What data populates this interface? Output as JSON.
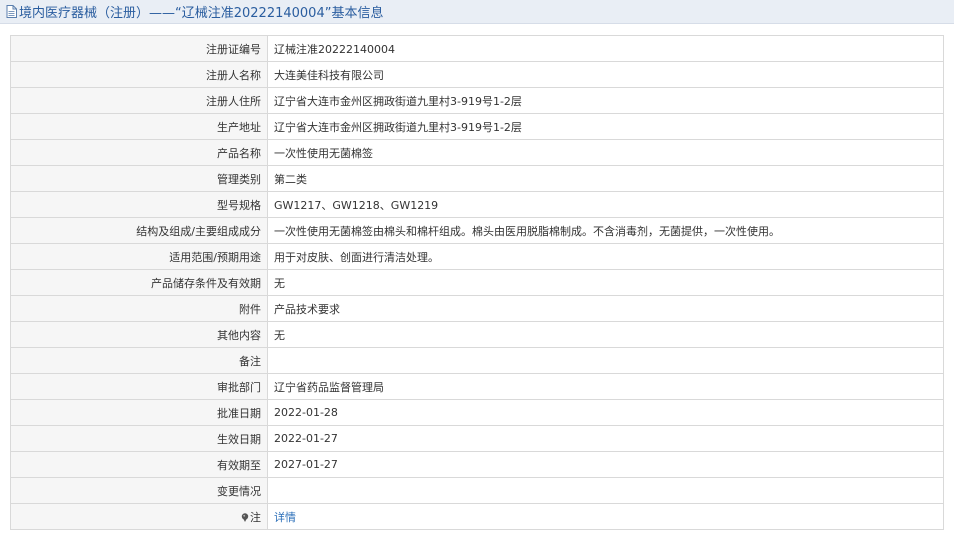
{
  "header": {
    "title": "境内医疗器械（注册）——“辽械注准20222140004”基本信息"
  },
  "rows": [
    {
      "label": "注册证编号",
      "value": "辽械注准20222140004"
    },
    {
      "label": "注册人名称",
      "value": "大连美佳科技有限公司"
    },
    {
      "label": "注册人住所",
      "value": "辽宁省大连市金州区拥政街道九里村3-919号1-2层"
    },
    {
      "label": "生产地址",
      "value": "辽宁省大连市金州区拥政街道九里村3-919号1-2层"
    },
    {
      "label": "产品名称",
      "value": "一次性使用无菌棉签"
    },
    {
      "label": "管理类别",
      "value": "第二类"
    },
    {
      "label": "型号规格",
      "value": "GW1217、GW1218、GW1219"
    },
    {
      "label": "结构及组成/主要组成成分",
      "value": "一次性使用无菌棉签由棉头和棉杆组成。棉头由医用脱脂棉制成。不含消毒剂，无菌提供，一次性使用。"
    },
    {
      "label": "适用范围/预期用途",
      "value": "用于对皮肤、创面进行清洁处理。"
    },
    {
      "label": "产品储存条件及有效期",
      "value": "无"
    },
    {
      "label": "附件",
      "value": "产品技术要求"
    },
    {
      "label": "其他内容",
      "value": "无"
    },
    {
      "label": "备注",
      "value": ""
    },
    {
      "label": "审批部门",
      "value": "辽宁省药品监督管理局"
    },
    {
      "label": "批准日期",
      "value": "2022-01-28"
    },
    {
      "label": "生效日期",
      "value": "2022-01-27"
    },
    {
      "label": "有效期至",
      "value": "2027-01-27"
    },
    {
      "label": "变更情况",
      "value": ""
    }
  ],
  "note_row": {
    "label": "注",
    "icon": "pin-icon",
    "link_text": "详情"
  }
}
